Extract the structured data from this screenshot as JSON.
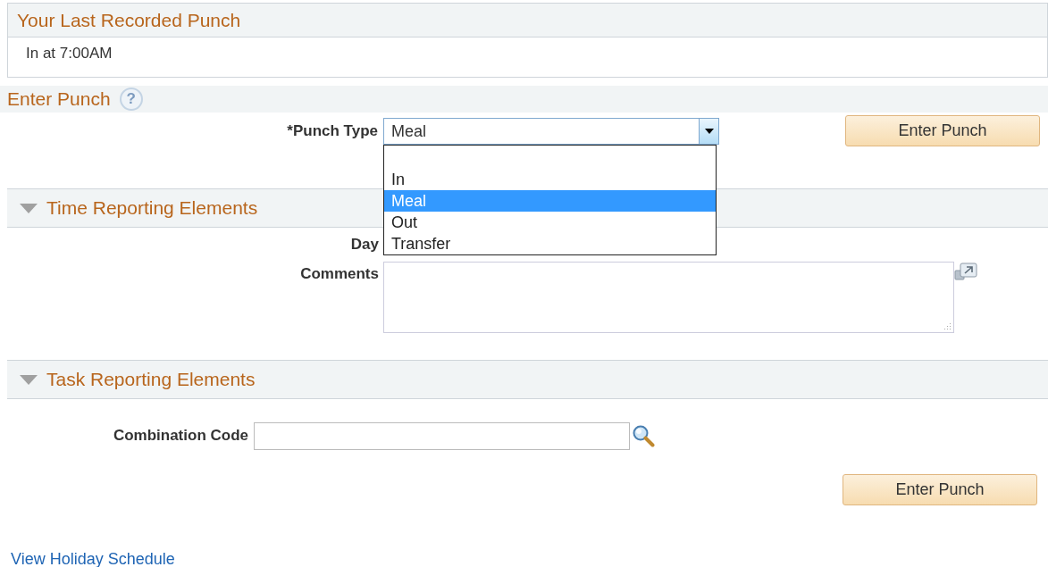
{
  "last_punch": {
    "title": "Your Last Recorded Punch",
    "value": "In at  7:00AM"
  },
  "enter_punch": {
    "title": "Enter Punch",
    "help_icon": "?",
    "punch_type": {
      "label": "*Punch Type",
      "value": "Meal",
      "expanded": true,
      "options": [
        {
          "label": "In",
          "selected": false
        },
        {
          "label": "Meal",
          "selected": true
        },
        {
          "label": "Out",
          "selected": false
        },
        {
          "label": "Transfer",
          "selected": false
        }
      ]
    },
    "button": "Enter Punch"
  },
  "time_reporting": {
    "title": "Time Reporting Elements",
    "expanded": true,
    "day_label": "Day",
    "comments_label": "Comments"
  },
  "task_reporting": {
    "title": "Task Reporting Elements",
    "expanded": true,
    "combination_code_label": "Combination Code"
  },
  "bottom_button": "Enter Punch",
  "link": "View Holiday Schedule"
}
